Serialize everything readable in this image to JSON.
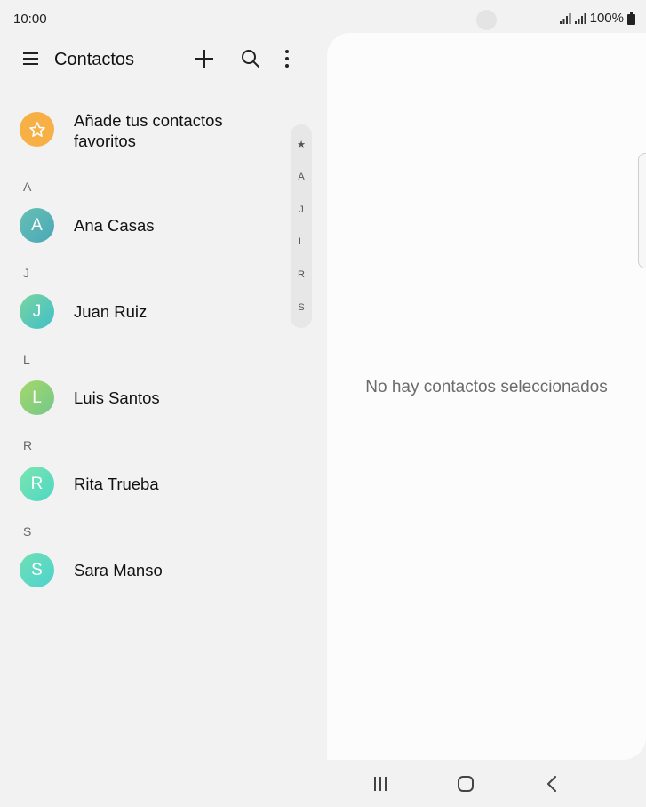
{
  "status_bar": {
    "time": "10:00",
    "battery": "100%"
  },
  "toolbar": {
    "title": "Contactos"
  },
  "favorites": {
    "label": "Añade tus contactos favoritos",
    "color": "#f7b045"
  },
  "sections": [
    {
      "letter": "A",
      "contacts": [
        {
          "initial": "A",
          "name": "Ana Casas",
          "color": "#5fbcb4"
        }
      ]
    },
    {
      "letter": "J",
      "contacts": [
        {
          "initial": "J",
          "name": "Juan Ruiz",
          "color": "#57ccc2"
        }
      ]
    },
    {
      "letter": "L",
      "contacts": [
        {
          "initial": "L",
          "name": "Luis Santos",
          "color": "#8ecf72"
        }
      ]
    },
    {
      "letter": "R",
      "contacts": [
        {
          "initial": "R",
          "name": "Rita Trueba",
          "color": "#6ee0bd"
        }
      ]
    },
    {
      "letter": "S",
      "contacts": [
        {
          "initial": "S",
          "name": "Sara Manso",
          "color": "#63dcc0"
        }
      ]
    }
  ],
  "index": [
    "★",
    "A",
    "J",
    "L",
    "R",
    "S"
  ],
  "detail": {
    "empty_message": "No hay contactos seleccionados"
  },
  "icons": {
    "menu": "menu-icon",
    "add": "plus-icon",
    "search": "search-icon",
    "more": "more-vert-icon",
    "favorite": "star-icon",
    "recents": "recents-icon",
    "home": "home-icon",
    "back": "back-icon"
  }
}
